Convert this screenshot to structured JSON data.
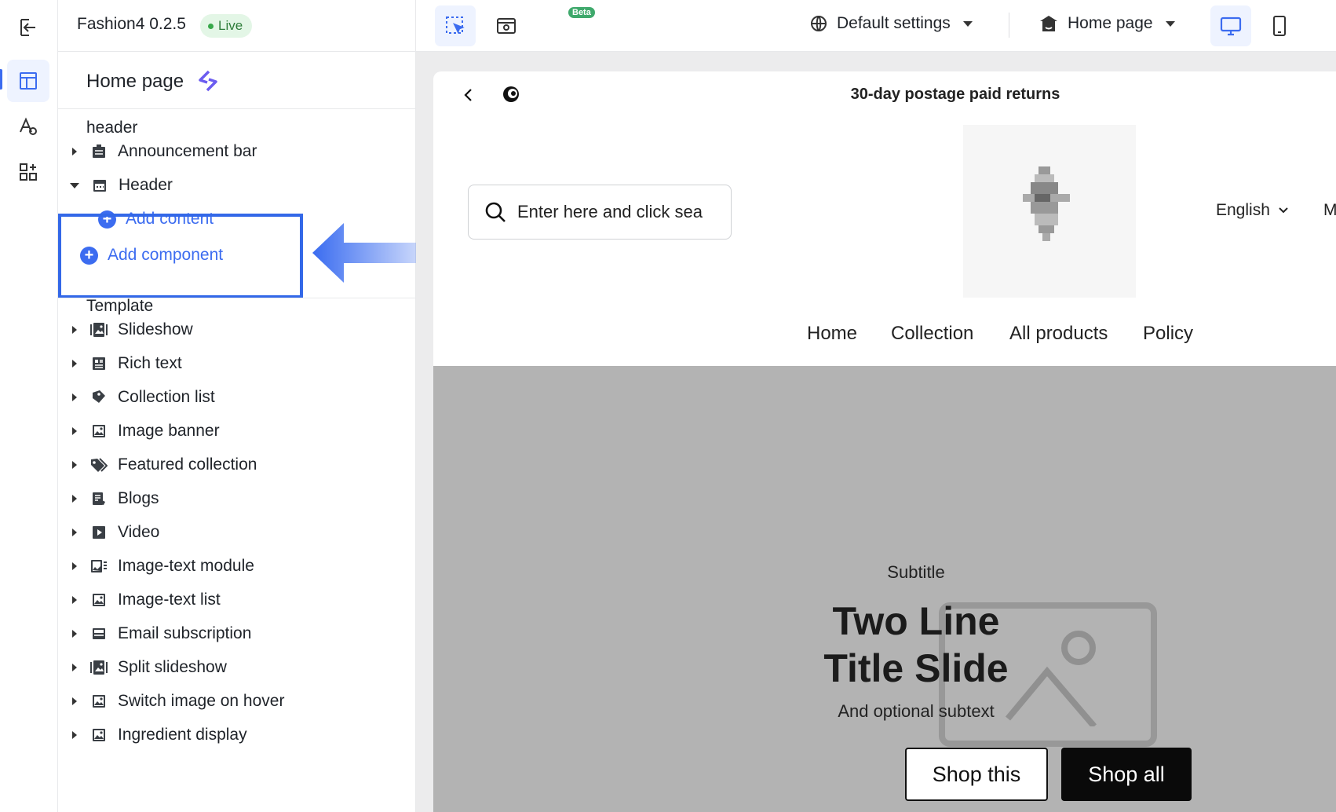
{
  "app": {
    "title": "Fashion4 0.2.5",
    "status": "Live"
  },
  "toolbar": {
    "beta_label": "Beta",
    "settings_dropdown": "Default settings",
    "page_dropdown": "Home page"
  },
  "panel": {
    "title": "Home page",
    "header_group": "header",
    "header_items": [
      {
        "label": "Announcement bar",
        "icon": "announcement-icon",
        "expanded": false
      },
      {
        "label": "Header",
        "icon": "header-layout-icon",
        "expanded": true
      }
    ],
    "add_content": "Add content",
    "add_component": "Add component",
    "template_group": "Template",
    "template_items": [
      {
        "label": "Slideshow",
        "icon": "slideshow-icon"
      },
      {
        "label": "Rich text",
        "icon": "rich-text-icon"
      },
      {
        "label": "Collection list",
        "icon": "collection-icon"
      },
      {
        "label": "Image banner",
        "icon": "image-icon"
      },
      {
        "label": "Featured collection",
        "icon": "tags-icon"
      },
      {
        "label": "Blogs",
        "icon": "blog-icon"
      },
      {
        "label": "Video",
        "icon": "video-icon"
      },
      {
        "label": "Image-text module",
        "icon": "image-text-icon"
      },
      {
        "label": "Image-text list",
        "icon": "image-icon"
      },
      {
        "label": "Email subscription",
        "icon": "email-icon"
      },
      {
        "label": "Split slideshow",
        "icon": "slideshow-icon"
      },
      {
        "label": "Switch image on hover",
        "icon": "image-icon"
      },
      {
        "label": "Ingredient display",
        "icon": "image-icon"
      }
    ]
  },
  "preview": {
    "announcement": "30-day postage paid returns",
    "search_placeholder": "Enter here and click sea",
    "language": "English",
    "language_overflow": "M",
    "nav": [
      "Home",
      "Collection",
      "All products",
      "Policy"
    ],
    "hero": {
      "subtitle": "Subtitle",
      "title_line1": "Two Line",
      "title_line2": "Title Slide",
      "subtext": "And optional subtext",
      "btn_primary": "Shop this",
      "btn_secondary": "Shop all"
    }
  },
  "colors": {
    "accent": "#3c6cf0",
    "live_bg": "#e3f6e6",
    "hero_bg": "#b3b3b3"
  }
}
